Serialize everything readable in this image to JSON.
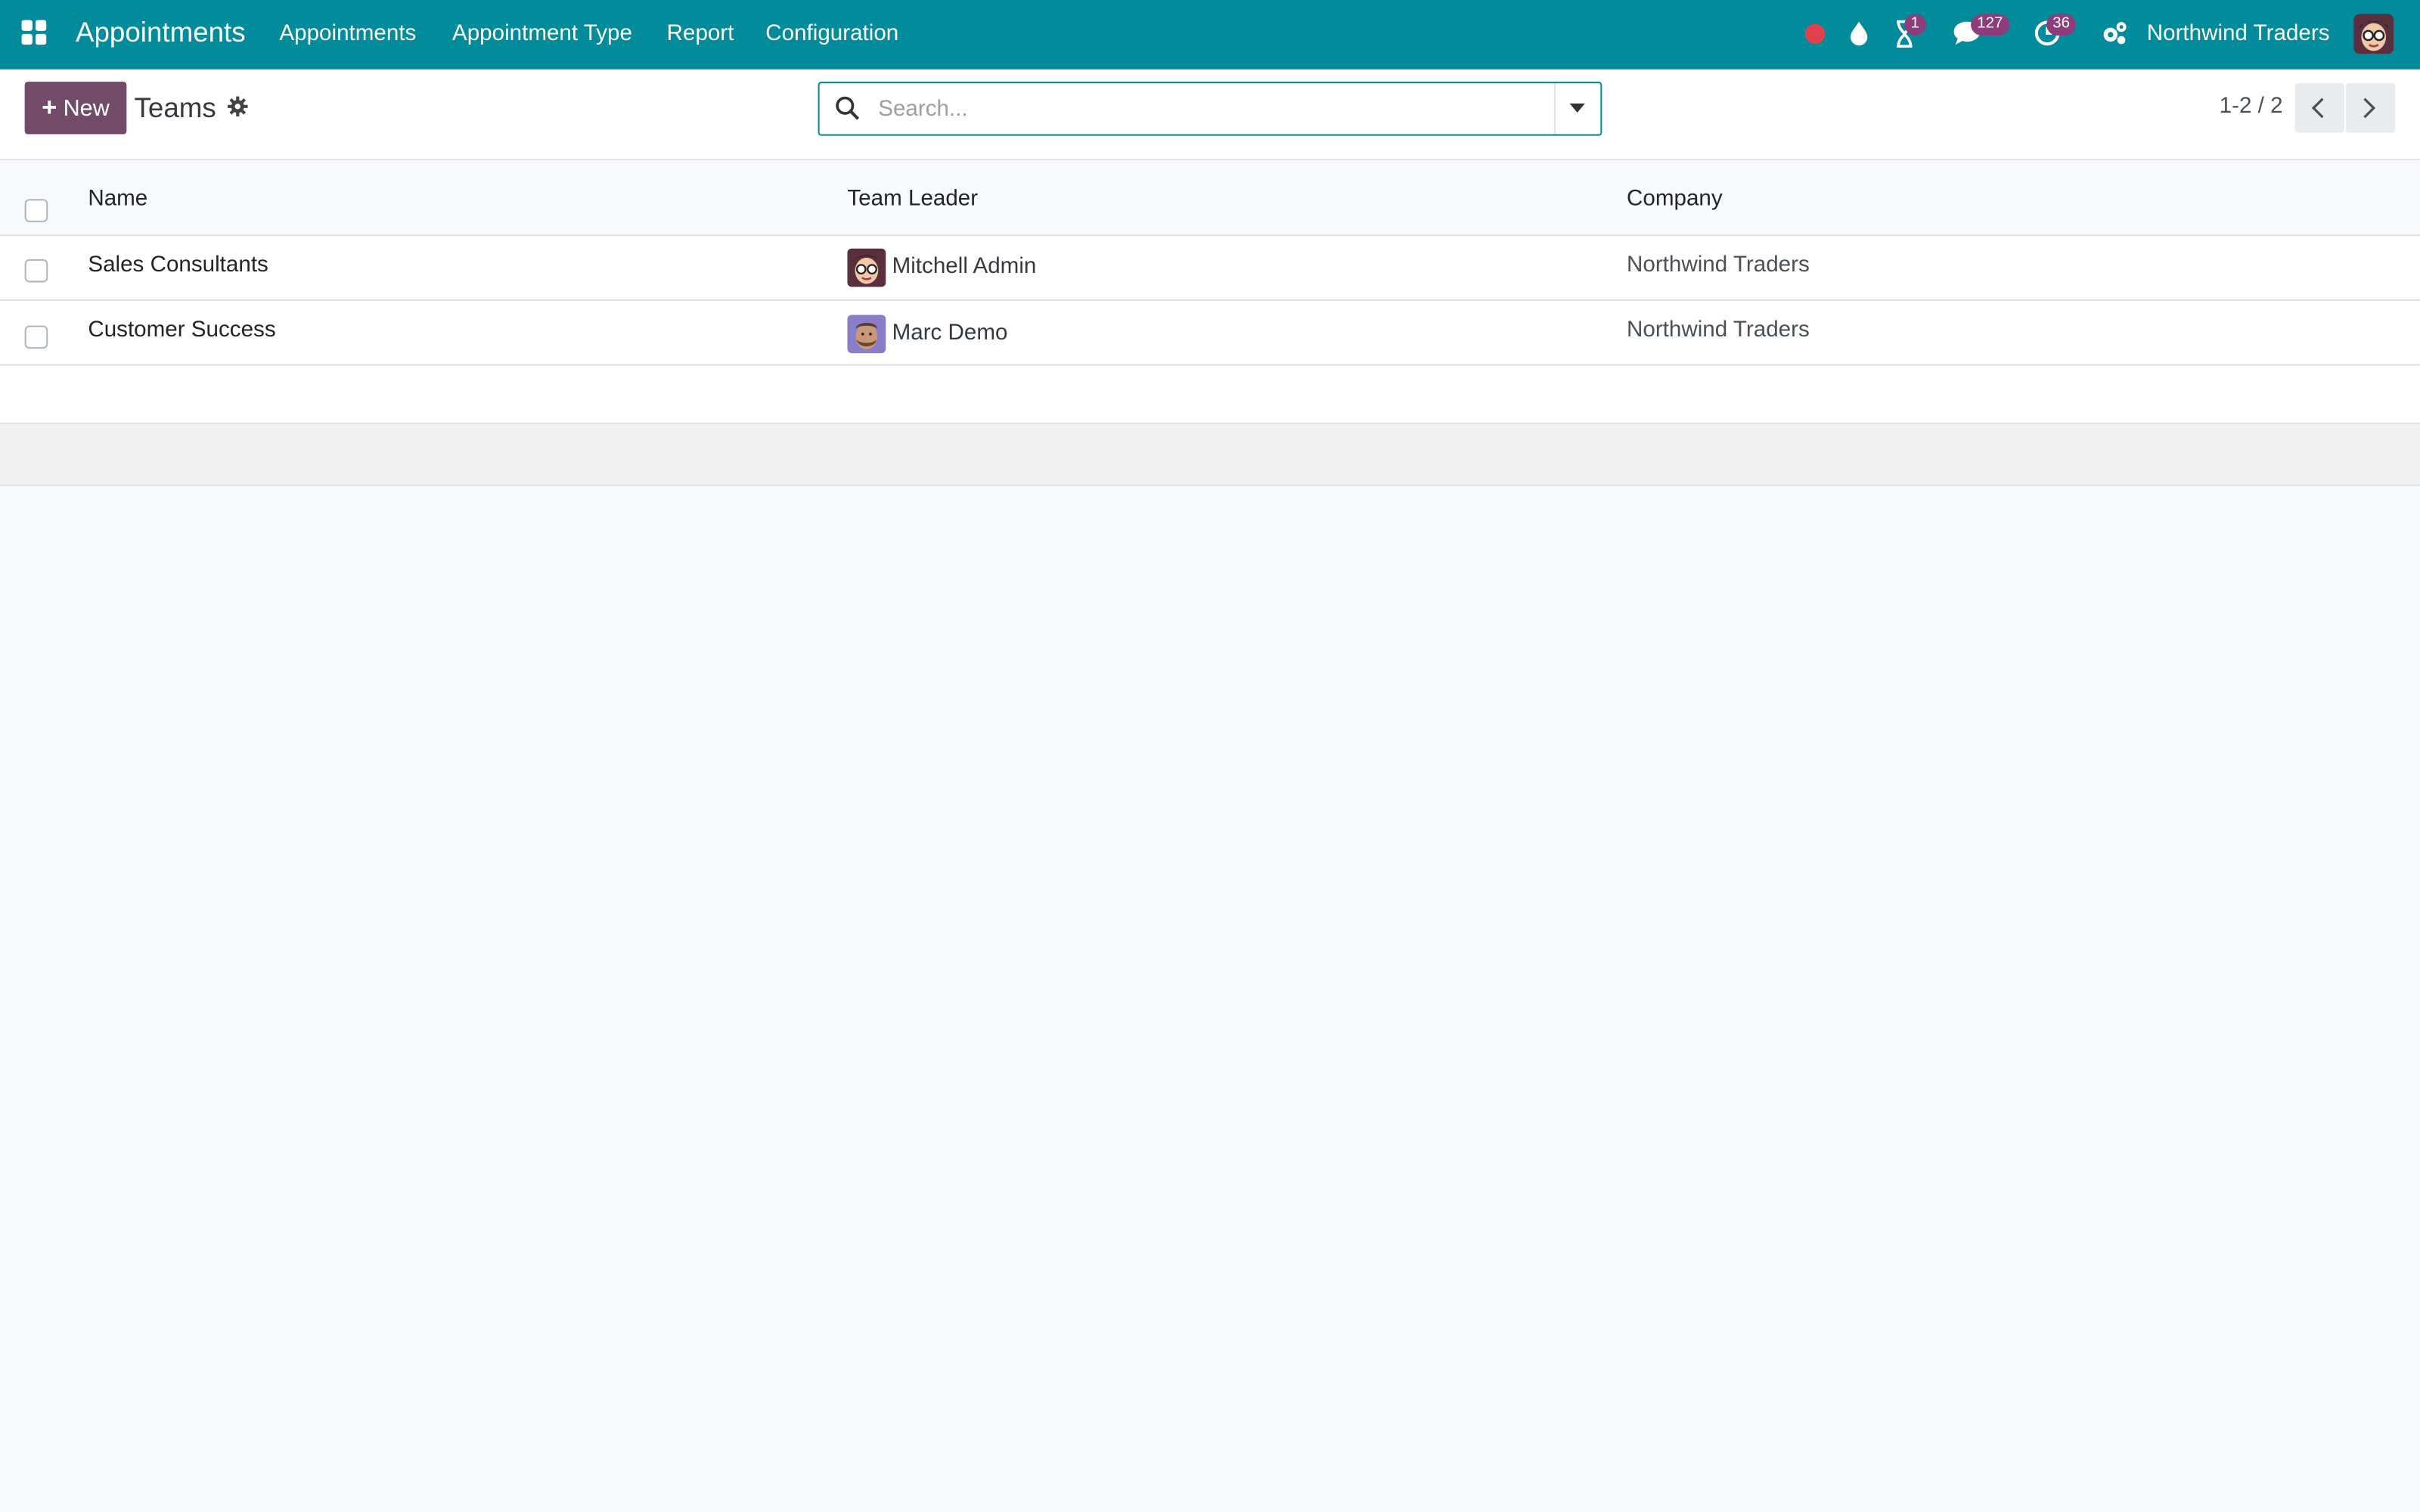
{
  "navbar": {
    "app_name": "Appointments",
    "menus": [
      "Appointments",
      "Appointment Type",
      "Report",
      "Configuration"
    ],
    "badges": {
      "activities": "1",
      "messages": "127",
      "timer": "36"
    },
    "company": "Northwind Traders",
    "color": "#018b9b"
  },
  "control": {
    "new_label": "New",
    "breadcrumb": "Teams",
    "search_placeholder": "Search...",
    "pager": "1-2 / 2",
    "accent": "#714b67"
  },
  "list": {
    "columns": [
      "Name",
      "Team Leader",
      "Company"
    ],
    "rows": [
      {
        "name": "Sales Consultants",
        "leader": "Mitchell Admin",
        "company": "Northwind Traders"
      },
      {
        "name": "Customer Success",
        "leader": "Marc Demo",
        "company": "Northwind Traders"
      }
    ]
  }
}
